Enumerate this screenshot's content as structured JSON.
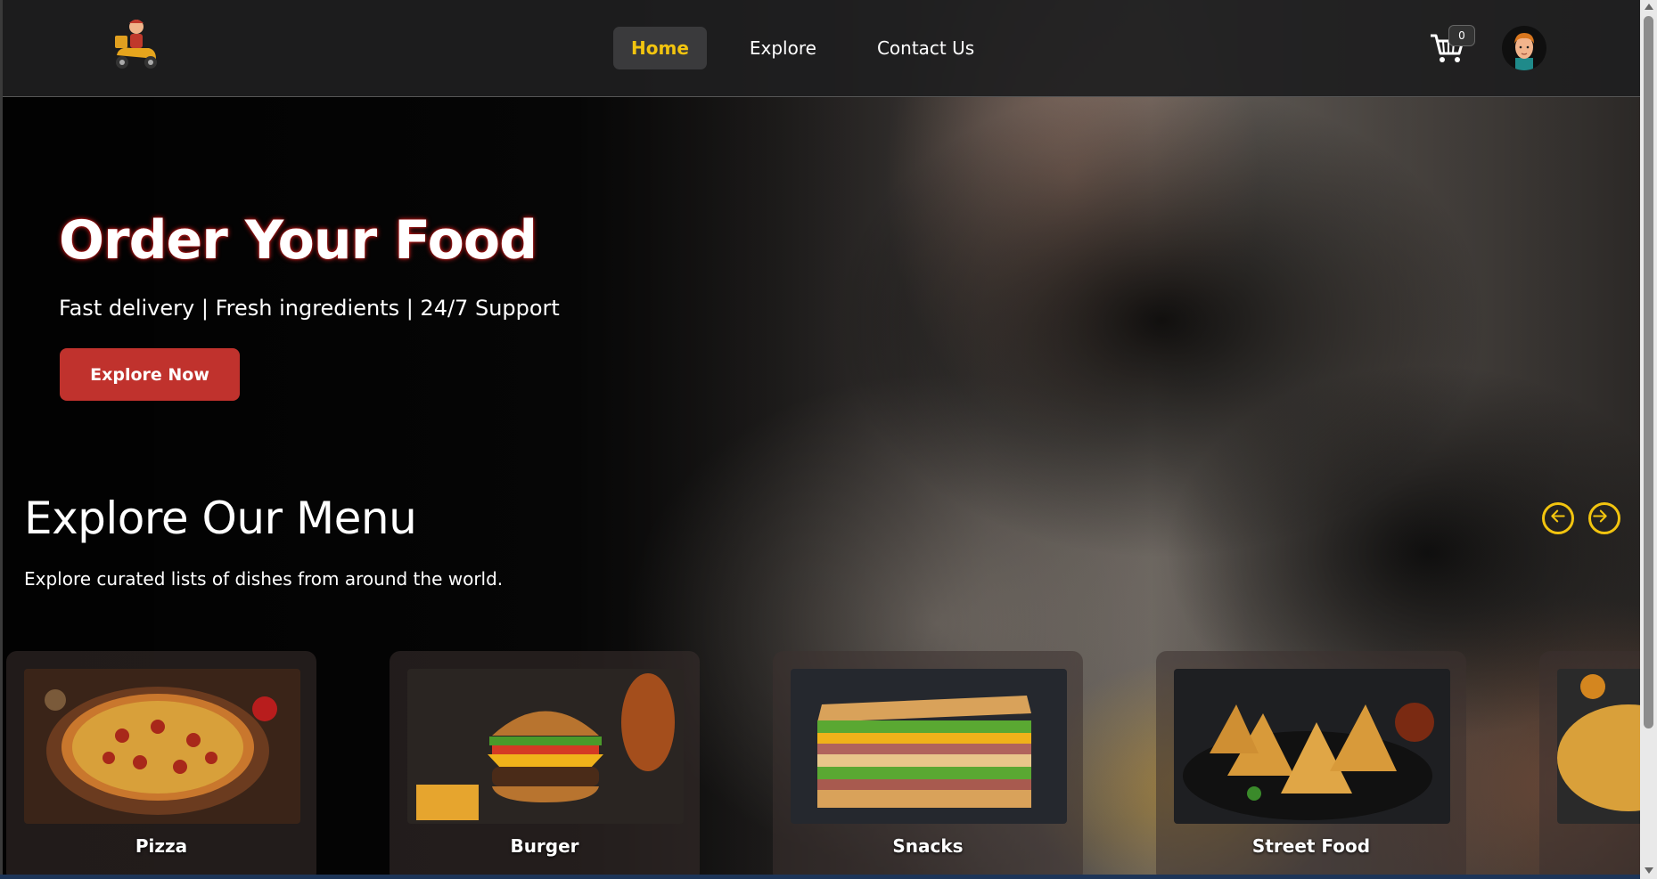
{
  "navbar": {
    "logo_icon": "delivery-scooter-icon",
    "links": [
      {
        "label": "Home",
        "active": true
      },
      {
        "label": "Explore",
        "active": false
      },
      {
        "label": "Contact Us",
        "active": false
      }
    ],
    "cart_count": "0",
    "cart_icon": "shopping-cart-icon",
    "avatar_icon": "user-avatar-icon"
  },
  "hero": {
    "title": "Order Your Food",
    "subtitle": "Fast delivery | Fresh ingredients | 24/7 Support",
    "cta_label": "Explore Now"
  },
  "menu": {
    "title": "Explore Our Menu",
    "subtitle": "Explore curated lists of dishes from around the world.",
    "prev_icon": "arrow-left-circle-icon",
    "next_icon": "arrow-right-circle-icon",
    "categories": [
      {
        "label": "Pizza"
      },
      {
        "label": "Burger"
      },
      {
        "label": "Snacks"
      },
      {
        "label": "Street Food"
      },
      {
        "label": ""
      }
    ]
  },
  "colors": {
    "accent": "#f2c40f",
    "cta": "#c0322d",
    "navbar": "#1e1e20"
  }
}
